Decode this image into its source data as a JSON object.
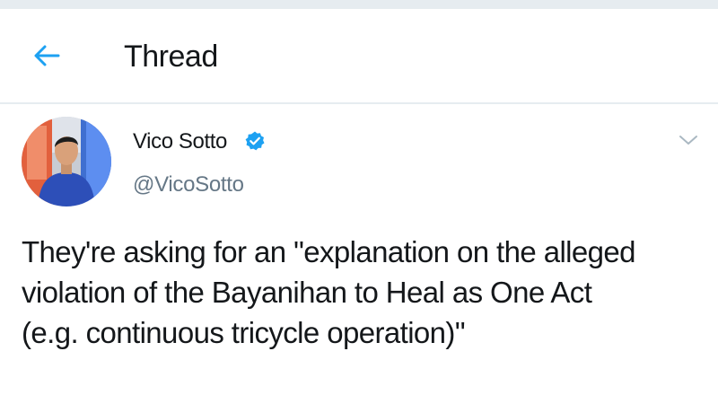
{
  "header": {
    "title": "Thread",
    "back_icon": "back-arrow-icon",
    "accent_color": "#1da1f2"
  },
  "tweet": {
    "author": {
      "name": "Vico Sotto",
      "handle": "@VicoSotto",
      "verified": true,
      "verified_icon": "verified-badge-icon",
      "verified_color": "#1da1f2"
    },
    "menu_icon": "chevron-down-icon",
    "text": "They're asking for an \"explanation on the alleged\nviolation of the Bayanihan to Heal as One Act\n(e.g. continuous tricycle operation)\""
  }
}
